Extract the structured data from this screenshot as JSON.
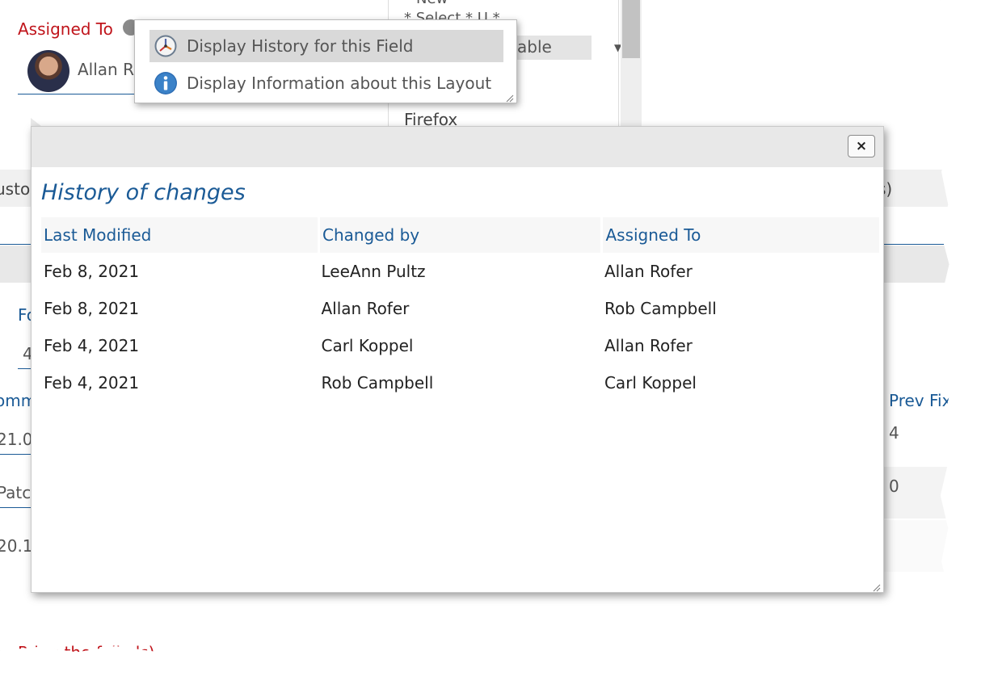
{
  "background": {
    "assigned_to_label": "Assigned To",
    "assignee_name": "Allan R",
    "dropdown_new": "New",
    "dropdown_select": "* Select * U *",
    "dropdown_able": "able",
    "dropdown_firefox": "Firefox",
    "custo_fragment": "usto",
    "paren_fragment": "s)",
    "fo_fragment": "Fo",
    "field_value_4": "4",
    "comm_fragment": "omm",
    "prev_fix_label": "Prev Fix",
    "row1_value": "21.0",
    "row1_right": "4",
    "row2_value": "Patc",
    "row2_right": "0",
    "row3_value": "20.1",
    "footer_fragment": "R     ing the follo     ls)"
  },
  "context_menu": {
    "items": [
      {
        "label": "Display History for this Field",
        "icon": "clock-history-icon"
      },
      {
        "label": "Display Information about this Layout",
        "icon": "info-icon"
      }
    ]
  },
  "history_dialog": {
    "close_label": "×",
    "title": "History of changes",
    "columns": [
      "Last Modified",
      "Changed by",
      "Assigned To"
    ],
    "rows": [
      [
        "Feb 8, 2021",
        "LeeAnn Pultz",
        "Allan Rofer"
      ],
      [
        "Feb 8, 2021",
        "Allan Rofer",
        "Rob Campbell"
      ],
      [
        "Feb 4, 2021",
        "Carl Koppel",
        "Allan Rofer"
      ],
      [
        "Feb 4, 2021",
        "Rob Campbell",
        "Carl Koppel"
      ]
    ]
  },
  "colors": {
    "accent_blue": "#1a5a96",
    "label_red": "#c0141b",
    "titlebar_gray": "#e8e8e8",
    "menu_highlight": "#d9d9d9"
  }
}
